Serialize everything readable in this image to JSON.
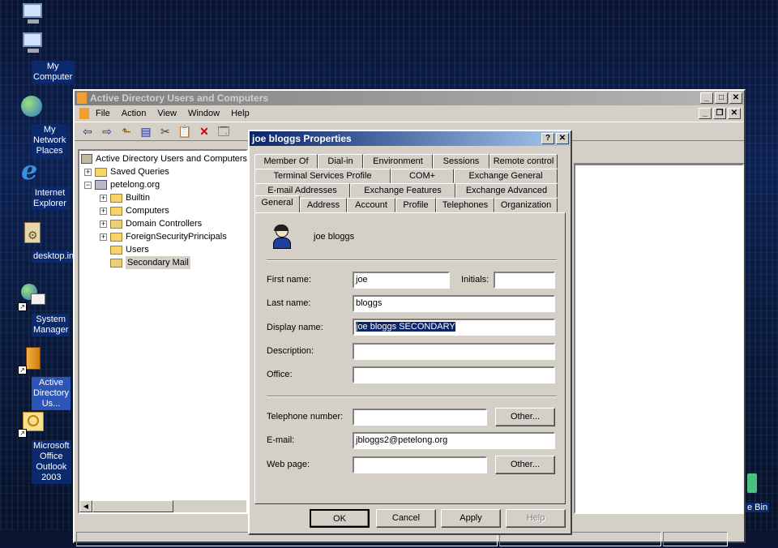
{
  "desktop": {
    "icons": [
      {
        "label": "",
        "icon": "computer-icon"
      },
      {
        "label": "My Computer",
        "icon": "computer-icon"
      },
      {
        "label": "My Network Places",
        "icon": "network-icon"
      },
      {
        "label": "Internet Explorer",
        "icon": "ie-icon"
      },
      {
        "label": "desktop.ini",
        "icon": "settings-file-icon"
      },
      {
        "label": "System Manager",
        "icon": "system-manager-icon"
      },
      {
        "label": "Active Directory Us...",
        "icon": "active-directory-icon"
      },
      {
        "label": "Microsoft Office Outlook 2003",
        "icon": "outlook-icon"
      }
    ],
    "recycle_bin_partial": "e Bin"
  },
  "main_window": {
    "title": "Active Directory Users and Computers",
    "menu": [
      "File",
      "Action",
      "View",
      "Window",
      "Help"
    ],
    "tree": {
      "root": "Active Directory Users and Computers",
      "items": [
        {
          "label": "Saved Queries"
        },
        {
          "label": "petelong.org"
        },
        {
          "label": "Builtin"
        },
        {
          "label": "Computers"
        },
        {
          "label": "Domain Controllers"
        },
        {
          "label": "ForeignSecurityPrincipals"
        },
        {
          "label": "Users"
        },
        {
          "label": "Secondary Mail"
        }
      ]
    }
  },
  "dialog": {
    "title": "joe bloggs Properties",
    "tabs_row1": [
      "Member Of",
      "Dial-in",
      "Environment",
      "Sessions",
      "Remote control"
    ],
    "tabs_row2": [
      "Terminal Services Profile",
      "COM+",
      "Exchange General"
    ],
    "tabs_row3": [
      "E-mail Addresses",
      "Exchange Features",
      "Exchange Advanced"
    ],
    "tabs_row4": [
      "General",
      "Address",
      "Account",
      "Profile",
      "Telephones",
      "Organization"
    ],
    "selected_tab": "General",
    "user_name": "joe bloggs",
    "labels": {
      "first_name": "First name:",
      "initials": "Initials:",
      "last_name": "Last name:",
      "display_name": "Display name:",
      "description": "Description:",
      "office": "Office:",
      "telephone": "Telephone number:",
      "email": "E-mail:",
      "web_page": "Web page:"
    },
    "values": {
      "first_name": "joe",
      "initials": "",
      "last_name": "bloggs",
      "display_name": "joe bloggs SECONDARY",
      "description": "",
      "office": "",
      "telephone": "",
      "email": "jbloggs2@petelong.org",
      "web_page": ""
    },
    "other_button": "Other...",
    "buttons": {
      "ok": "OK",
      "cancel": "Cancel",
      "apply": "Apply",
      "help": "Help"
    }
  }
}
